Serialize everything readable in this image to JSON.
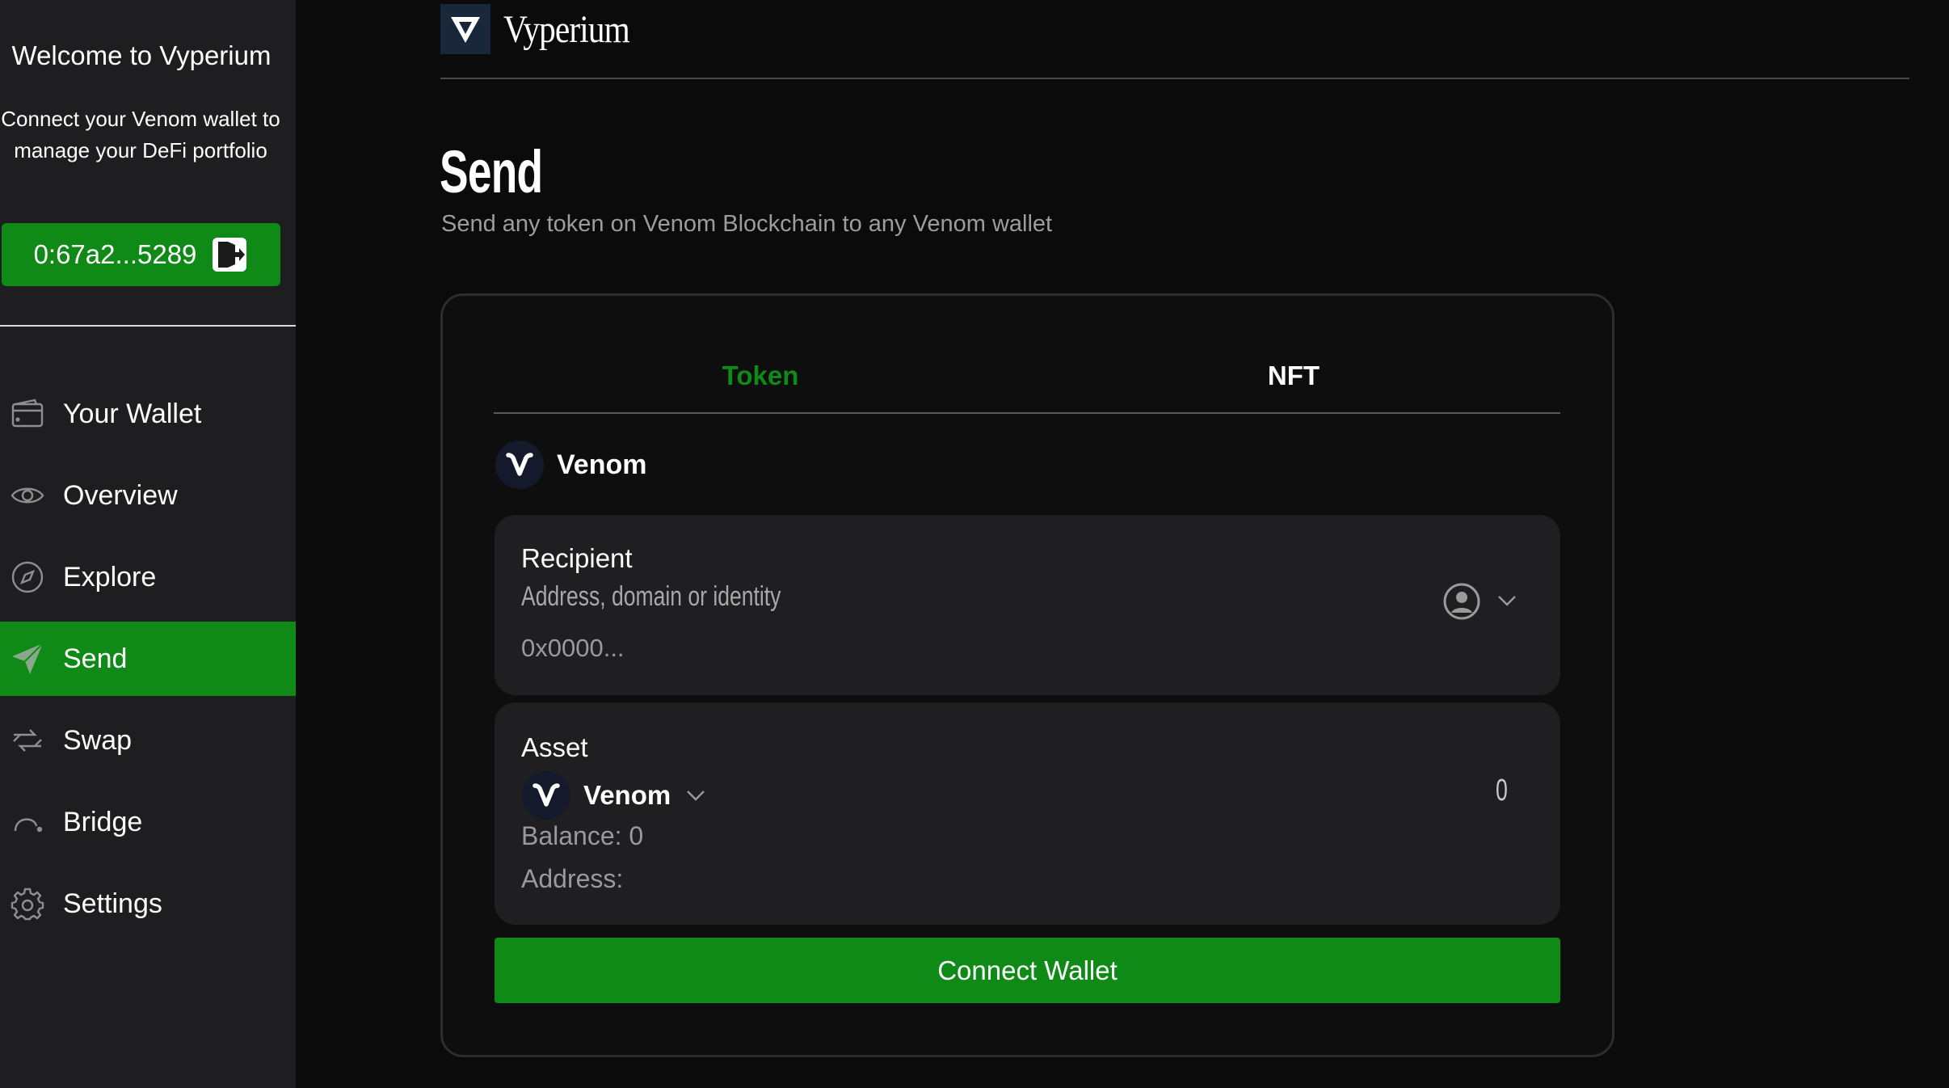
{
  "sidebar": {
    "welcome_title": "Welcome to Vyperium",
    "welcome_text": "Connect your Venom wallet to manage your DeFi portfolio",
    "wallet_address": "0:67a2...5289",
    "items": [
      {
        "label": "Your Wallet",
        "icon": "wallet-icon",
        "active": false
      },
      {
        "label": "Overview",
        "icon": "eye-icon",
        "active": false
      },
      {
        "label": "Explore",
        "icon": "compass-icon",
        "active": false
      },
      {
        "label": "Send",
        "icon": "send-icon",
        "active": true
      },
      {
        "label": "Swap",
        "icon": "swap-icon",
        "active": false
      },
      {
        "label": "Bridge",
        "icon": "bridge-icon",
        "active": false
      },
      {
        "label": "Settings",
        "icon": "gear-icon",
        "active": false
      }
    ]
  },
  "header": {
    "brand": "Vyperium"
  },
  "page": {
    "title": "Send",
    "subtitle": "Send any token on Venom Blockchain to any Venom wallet"
  },
  "tabs": {
    "token": "Token",
    "nft": "NFT"
  },
  "token": {
    "name": "Venom"
  },
  "recipient": {
    "label": "Recipient",
    "hint": "Address, domain or identity",
    "placeholder": "0x0000..."
  },
  "asset": {
    "label": "Asset",
    "name": "Venom",
    "amount": "0",
    "balance": "Balance: 0",
    "address": "Address:"
  },
  "actions": {
    "connect": "Connect Wallet"
  },
  "colors": {
    "accent": "#108a17",
    "sidebar_bg": "#1e1e21",
    "panel_bg": "#1f1f22",
    "page_bg": "#0b0b0b"
  }
}
